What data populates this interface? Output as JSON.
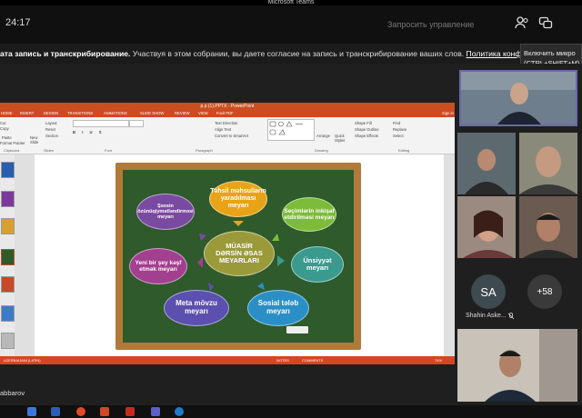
{
  "app": {
    "title": "Microsoft Teams"
  },
  "toolbar": {
    "timer": "24:17",
    "request_control": "Запросить управление"
  },
  "banner": {
    "strong": "ата запись и транскрибирование.",
    "text": "Участвуя в этом собрании, вы даете согласие на запись и транскрибирование ваших слов.",
    "link": "Политика конфиденциальности"
  },
  "tooltip": {
    "line1": "Включить микро",
    "line2": "(CTRL+SHIFT+M)"
  },
  "powerpoint": {
    "title": "p.p (1).PPTX - PowerPoint",
    "tabs": [
      "HOME",
      "INSERT",
      "DESIGN",
      "TRANSITIONS",
      "ANIMATIONS",
      "SLIDE SHOW",
      "REVIEW",
      "VIEW",
      "Foxit PDF"
    ],
    "signin": "Sign in",
    "ribbon": {
      "paste": "Paste",
      "cut": "Cut",
      "copy": "Copy",
      "format_painter": "Format Painter",
      "new_slide": "New Slide",
      "layout": "Layout",
      "reset": "Reset",
      "section": "Section",
      "text_direction": "Text Direction",
      "align_text": "Align Text",
      "convert_smartart": "Convert to SmartArt",
      "arrange": "Arrange",
      "quick_styles": "Quick Styles",
      "shape_fill": "Shape Fill",
      "shape_outline": "Shape Outline",
      "shape_effects": "Shape Effects",
      "find": "Find",
      "replace": "Replace",
      "select": "Select"
    },
    "groups": [
      "Clipboard",
      "Slides",
      "Font",
      "Paragraph",
      "Drawing",
      "Editing"
    ],
    "status_left": "AZERBAIJANI (LATIN)",
    "notes": "NOTES",
    "comments": "COMMENTS",
    "zoom": "74%"
  },
  "slide": {
    "center": [
      "MÜASİR",
      "DƏRSİN ƏSAS",
      "MEYARLARI"
    ],
    "bubbles": [
      {
        "text": "Təhsil məhsulların yaradılması meyarı",
        "color": "#e8a317"
      },
      {
        "text": "Seçimlərin inkişaf etdirilməsi meyarı",
        "color": "#7dbb3a"
      },
      {
        "text": "Ünsiyyət meyarı",
        "color": "#3a9a8e"
      },
      {
        "text": "Sosial tələb meyarı",
        "color": "#2a8fc7"
      },
      {
        "text": "Meta mövzu meyarı",
        "color": "#5b4fb0"
      },
      {
        "text": "Yeni bir şey kəşf etmək meyarı",
        "color": "#a23f8f"
      },
      {
        "text": "Şəxsin özünüqiymətləndirməsi meyarı",
        "color": "#7a4aa0"
      }
    ]
  },
  "participants": {
    "avatar_initials": "SA",
    "avatar_name": "Shahin Aske...",
    "overflow": "+58"
  },
  "bottom_name": "abbarov"
}
